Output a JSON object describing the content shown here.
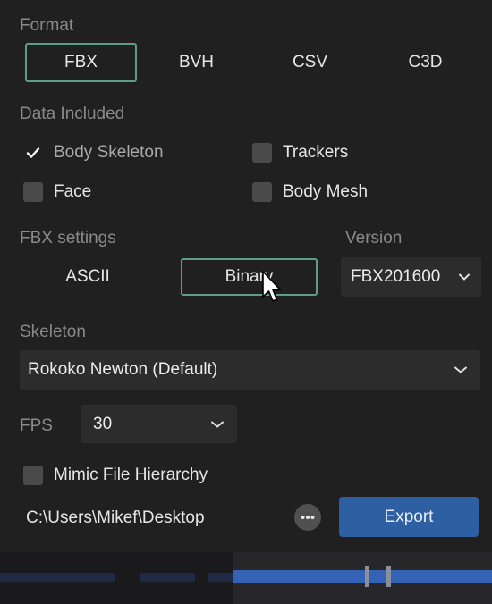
{
  "format": {
    "label": "Format",
    "options": [
      "FBX",
      "BVH",
      "CSV",
      "C3D"
    ],
    "selected": "FBX"
  },
  "data_included": {
    "label": "Data Included",
    "items": [
      {
        "label": "Body Skeleton",
        "checked": true
      },
      {
        "label": "Trackers",
        "checked": false
      },
      {
        "label": "Face",
        "checked": false
      },
      {
        "label": "Body Mesh",
        "checked": false
      }
    ]
  },
  "fbx_settings": {
    "label": "FBX settings",
    "options": [
      "ASCII",
      "Binary"
    ],
    "selected": "Binary"
  },
  "version": {
    "label": "Version",
    "value": "FBX201600"
  },
  "skeleton": {
    "label": "Skeleton",
    "value": "Rokoko Newton (Default)"
  },
  "fps": {
    "label": "FPS",
    "value": "30"
  },
  "mimic": {
    "label": "Mimic File Hierarchy",
    "checked": false
  },
  "path": {
    "value": "C:\\Users\\Mikef\\Desktop"
  },
  "export": {
    "label": "Export"
  },
  "colors": {
    "background": "#202020",
    "accent_border": "#5f9e86",
    "export_button": "#2f5fa3"
  }
}
